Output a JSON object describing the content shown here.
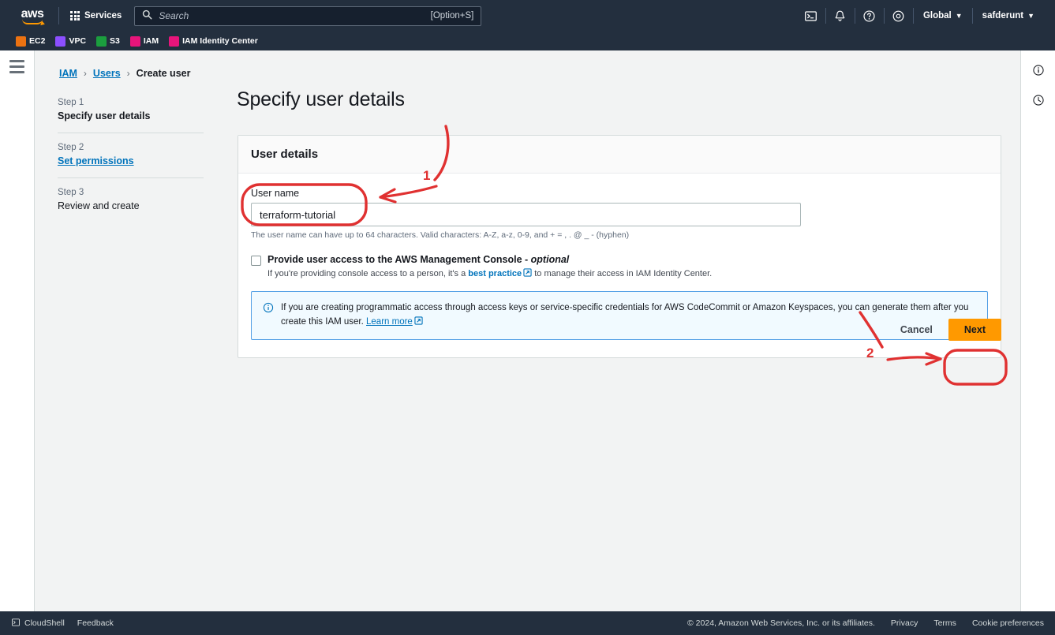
{
  "topnav": {
    "logo_text": "aws",
    "services_label": "Services",
    "search": {
      "placeholder": "Search",
      "shortcut": "[Option+S]",
      "icon": "search-icon"
    },
    "icons": [
      {
        "name": "cloudshell-icon"
      },
      {
        "name": "notifications-bell-icon"
      },
      {
        "name": "help-question-icon"
      },
      {
        "name": "settings-gear-icon"
      }
    ],
    "region_label": "Global",
    "account_label": "safderunt",
    "caret": "▼"
  },
  "service_shortcuts": [
    {
      "label": "EC2",
      "color": "#ec7211",
      "glyph": "⬚"
    },
    {
      "label": "VPC",
      "color": "#8c4fff",
      "glyph": "⬚"
    },
    {
      "label": "S3",
      "color": "#1b9e3e",
      "glyph": "⬚"
    },
    {
      "label": "IAM",
      "color": "#e7157b",
      "glyph": "⬚"
    },
    {
      "label": "IAM Identity Center",
      "color": "#e7157b",
      "glyph": "⬚"
    }
  ],
  "left_rail": {
    "menu_icon": "hamburger-menu-icon"
  },
  "right_rail": [
    {
      "name": "info-icon"
    },
    {
      "name": "history-clock-icon"
    }
  ],
  "breadcrumb": [
    {
      "label": "IAM",
      "link": true
    },
    {
      "label": "Users",
      "link": true
    },
    {
      "label": "Create user",
      "link": false
    }
  ],
  "breadcrumb_separator": "›",
  "steps": [
    {
      "num": "Step 1",
      "title": "Specify user details",
      "state": "current"
    },
    {
      "num": "Step 2",
      "title": "Set permissions",
      "state": "link"
    },
    {
      "num": "Step 3",
      "title": "Review and create",
      "state": "plain"
    }
  ],
  "page_title": "Specify user details",
  "card": {
    "header": "User details",
    "username_label": "User name",
    "username_value": "terraform-tutorial",
    "username_placeholder": "",
    "username_hint": "The user name can have up to 64 characters. Valid characters: A-Z, a-z, 0-9, and + = , . @ _ - (hyphen)",
    "console_access": {
      "checked": false,
      "label_main": "Provide user access to the AWS Management Console - ",
      "label_optional": "optional",
      "sub_before": "If you're providing console access to a person, it's a ",
      "sub_link": "best practice",
      "sub_after": " to manage their access in IAM Identity Center."
    },
    "alert": {
      "icon": "info-circle-icon",
      "text": "If you are creating programmatic access through access keys or service-specific credentials for AWS CodeCommit or Amazon Keyspaces, you can generate them after you create this IAM user. ",
      "link": "Learn more"
    }
  },
  "actions": {
    "cancel_label": "Cancel",
    "next_label": "Next",
    "next_color": "#ff9900"
  },
  "footer": {
    "cloudshell_label": "CloudShell",
    "feedback_label": "Feedback",
    "copyright": "© 2024, Amazon Web Services, Inc. or its affiliates.",
    "links": [
      "Privacy",
      "Terms",
      "Cookie preferences"
    ]
  },
  "annotations": [
    {
      "label": "1",
      "target": "username-field",
      "color": "#e03131"
    },
    {
      "label": "2",
      "target": "next-button",
      "color": "#e03131"
    }
  ]
}
